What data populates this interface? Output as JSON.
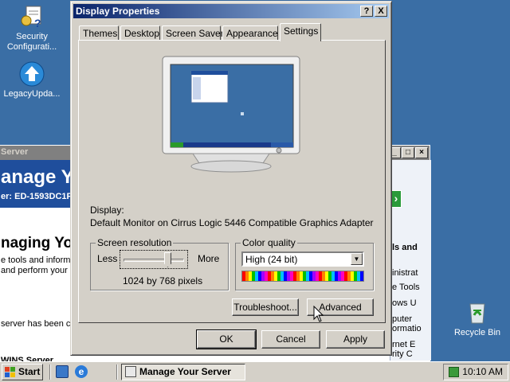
{
  "desktop": {
    "icons": [
      {
        "label_line1": "Security",
        "label_line2": "Configurati..."
      },
      {
        "label_line1": "LegacyUpda...",
        "label_line2": ""
      },
      {
        "label_line1": "Recycle Bin",
        "label_line2": ""
      }
    ]
  },
  "bg_window": {
    "title": "Server",
    "heading": "anage Y",
    "server_line": "er: ED-1593DC1F4",
    "subheading": "naging Yo",
    "text1": "e tools and inform",
    "text2": "and perform your c",
    "text3": "server has been co",
    "text4": "WINS Server",
    "right_bold": "ls and",
    "right_lines": [
      "inistrat",
      "e Tools",
      "ows U",
      "puter",
      "ormatio",
      "rnet E",
      "rity C"
    ]
  },
  "dialog": {
    "title": "Display Properties",
    "help_btn": "?",
    "close_btn": "X",
    "tabs": [
      "Themes",
      "Desktop",
      "Screen Saver",
      "Appearance",
      "Settings"
    ],
    "active_tab": "Settings",
    "display_label": "Display:",
    "display_value": "Default Monitor on Cirrus Logic 5446 Compatible Graphics Adapter",
    "resolution": {
      "group_label": "Screen resolution",
      "less": "Less",
      "more": "More",
      "value": "1024 by 768 pixels",
      "slider_fraction": 0.75
    },
    "color_quality": {
      "group_label": "Color quality",
      "selected": "High (24 bit)"
    },
    "troubleshoot_btn": "Troubleshoot...",
    "advanced_btn": "Advanced",
    "ok_btn": "OK",
    "cancel_btn": "Cancel",
    "apply_btn": "Apply"
  },
  "taskbar": {
    "start_label": "Start",
    "task_label": "Manage Your Server",
    "clock": "10:10 AM"
  },
  "colors": {
    "desktop": "#3a6ea5",
    "title_active_start": "#0a246a",
    "title_active_end": "#a6caf0",
    "face": "#d4d0c8"
  }
}
